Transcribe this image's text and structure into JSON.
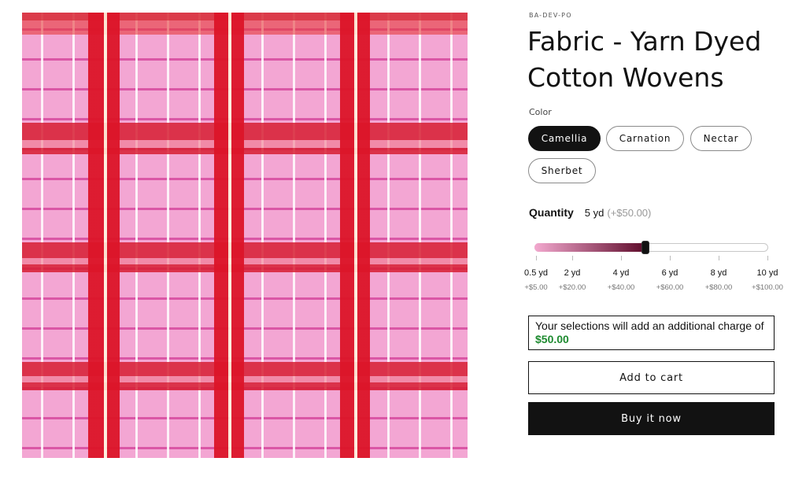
{
  "product": {
    "vendor": "BA-DEV-PO",
    "title": "Fabric - Yarn Dyed Cotton Wovens"
  },
  "color": {
    "label": "Color",
    "options": [
      "Camellia",
      "Carnation",
      "Nectar",
      "Sherbet"
    ],
    "selected": "Camellia"
  },
  "quantity": {
    "label": "Quantity",
    "value": "5 yd",
    "delta": "(+$50.00)",
    "slider_value_yd": 5,
    "slider_min_yd": 0.5,
    "slider_max_yd": 10,
    "ticks": [
      {
        "label": "0.5 yd",
        "price": "+$5.00"
      },
      {
        "label": "2 yd",
        "price": "+$20.00"
      },
      {
        "label": "4 yd",
        "price": "+$40.00"
      },
      {
        "label": "6 yd",
        "price": "+$60.00"
      },
      {
        "label": "8 yd",
        "price": "+$80.00"
      },
      {
        "label": "10 yd",
        "price": "+$100.00"
      }
    ],
    "colors": {
      "fill_start": "#f3a9cf",
      "fill_end": "#5e0b2a",
      "thumb": "#111111"
    }
  },
  "notice": {
    "text": "Your selections will add an additional charge of",
    "amount": "$50.00",
    "amount_color": "#1d8a2f"
  },
  "actions": {
    "add_to_cart": "Add to cart",
    "buy_now": "Buy it now"
  },
  "image": {
    "icon": "plaid-fabric-image",
    "colors": {
      "base": "#f3a6d3",
      "stripe": "#dc1428"
    }
  }
}
